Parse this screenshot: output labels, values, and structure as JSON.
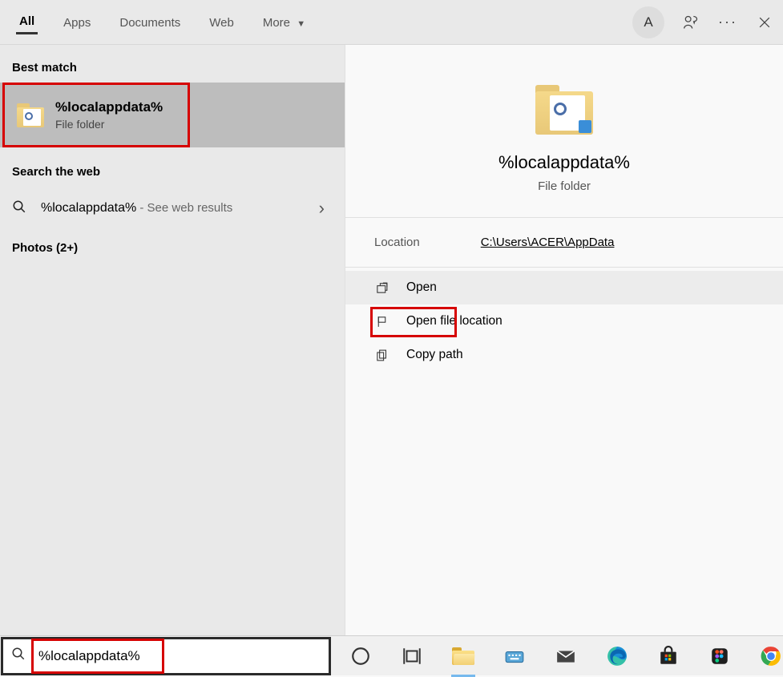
{
  "topbar": {
    "tabs": {
      "all": "All",
      "apps": "Apps",
      "documents": "Documents",
      "web": "Web",
      "more": "More"
    },
    "avatar_initial": "A"
  },
  "left_pane": {
    "best_match_label": "Best match",
    "best_match": {
      "title": "%localappdata%",
      "subtitle": "File folder"
    },
    "search_web_label": "Search the web",
    "web_result": {
      "term": "%localappdata%",
      "suffix": " - See web results"
    },
    "photos_label": "Photos (2+)"
  },
  "preview": {
    "title": "%localappdata%",
    "subtitle": "File folder",
    "location_label": "Location",
    "location_value": "C:\\Users\\ACER\\AppData",
    "actions": {
      "open": "Open",
      "open_location": "Open file location",
      "copy_path": "Copy path"
    }
  },
  "taskbar": {
    "search_value": "%localappdata%"
  }
}
